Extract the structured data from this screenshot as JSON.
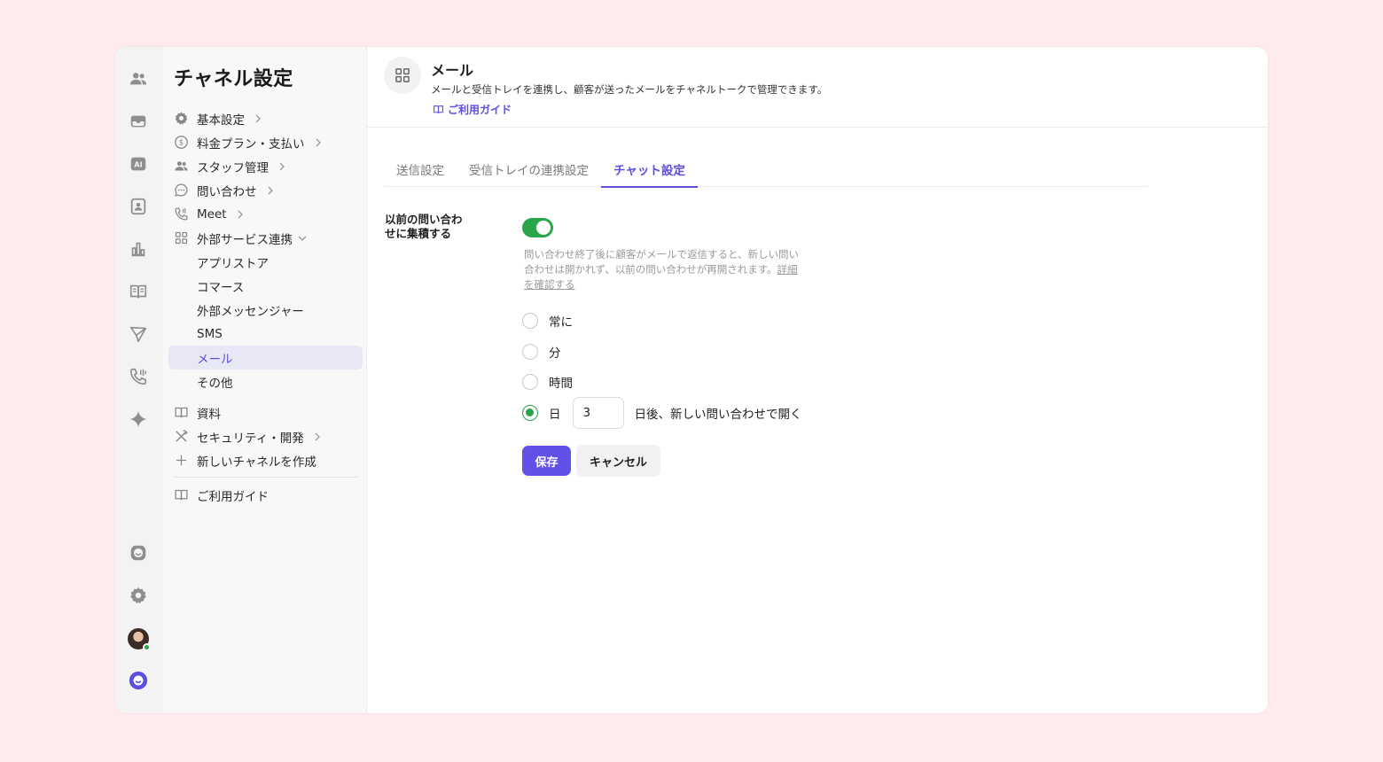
{
  "sidebar": {
    "title": "チャネル設定",
    "items": [
      {
        "label": "基本設定",
        "icon": "gear-icon"
      },
      {
        "label": "料金プラン・支払い",
        "icon": "dollar-icon"
      },
      {
        "label": "スタッフ管理",
        "icon": "users-icon"
      },
      {
        "label": "問い合わせ",
        "icon": "chat-bubble-icon"
      },
      {
        "label": "Meet",
        "icon": "phone-icon"
      },
      {
        "label": "外部サービス連携",
        "icon": "grid-icon"
      }
    ],
    "sub_items": [
      "アプリストア",
      "コマース",
      "外部メッセンジャー",
      "SMS",
      "メール",
      "その他"
    ],
    "items2": [
      {
        "label": "資料",
        "icon": "book-icon"
      },
      {
        "label": "セキュリティ・開発",
        "icon": "tools-icon"
      },
      {
        "label": "新しいチャネルを作成",
        "icon": "plus-icon"
      }
    ],
    "guide": "ご利用ガイド"
  },
  "header": {
    "title": "メール",
    "description": "メールと受信トレイを連携し、顧客が送ったメールをチャネルトークで管理できます。",
    "guide_link": "ご利用ガイド"
  },
  "tabs": [
    "送信設定",
    "受信トレイの連携設定",
    "チャット設定"
  ],
  "active_tab": "チャット設定",
  "setting": {
    "label": "以前の問い合わせに集積する",
    "label_line1": "以前の問い合わ",
    "label_line2": "せに集積する",
    "enabled": true,
    "help_line1": "問い合わせ終了後に顧客がメールで返信すると、新しい問い",
    "help_line2": "合わせは開かれず、以前の問い合わせが再開されます。",
    "help_link_part1": "詳細",
    "help_link_part2": "を確認する",
    "options": [
      "常に",
      "分",
      "時間",
      "日"
    ],
    "selected": "日",
    "days_value": "3",
    "days_suffix": "日後、新しい問い合わせで開く"
  },
  "buttons": {
    "save": "保存",
    "cancel": "キャンセル"
  },
  "colors": {
    "accent": "#5b4fe0",
    "toggle_on": "#2aa54a",
    "background": "#fdebee"
  }
}
